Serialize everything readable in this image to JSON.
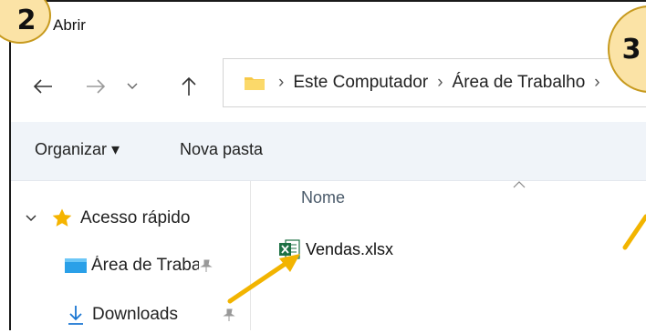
{
  "window": {
    "title": "Abrir"
  },
  "badges": {
    "left": "2",
    "right": "3"
  },
  "nav": {
    "back_icon": "arrow-left-icon",
    "forward_icon": "arrow-right-icon",
    "recent_icon": "chevron-down-icon",
    "up_icon": "arrow-up-icon"
  },
  "address": {
    "crumbs": [
      "Este Computador",
      "Área de Trabalho"
    ],
    "separator": "›"
  },
  "toolbar": {
    "organize_label": "Organizar ▾",
    "new_folder_label": "Nova pasta"
  },
  "sidebar": {
    "quick_access_label": "Acesso rápido",
    "items": [
      {
        "label": "Área de Trabalho",
        "icon": "desktop-folder-icon"
      },
      {
        "label": "Downloads",
        "icon": "download-icon"
      }
    ]
  },
  "content": {
    "column_name": "Nome",
    "files": [
      {
        "name": "Vendas.xlsx",
        "icon": "excel-file-icon"
      }
    ]
  },
  "colors": {
    "accent_arrow": "#f2b400",
    "badge_fill": "#fbe3a6",
    "excel_green": "#1d7044"
  }
}
